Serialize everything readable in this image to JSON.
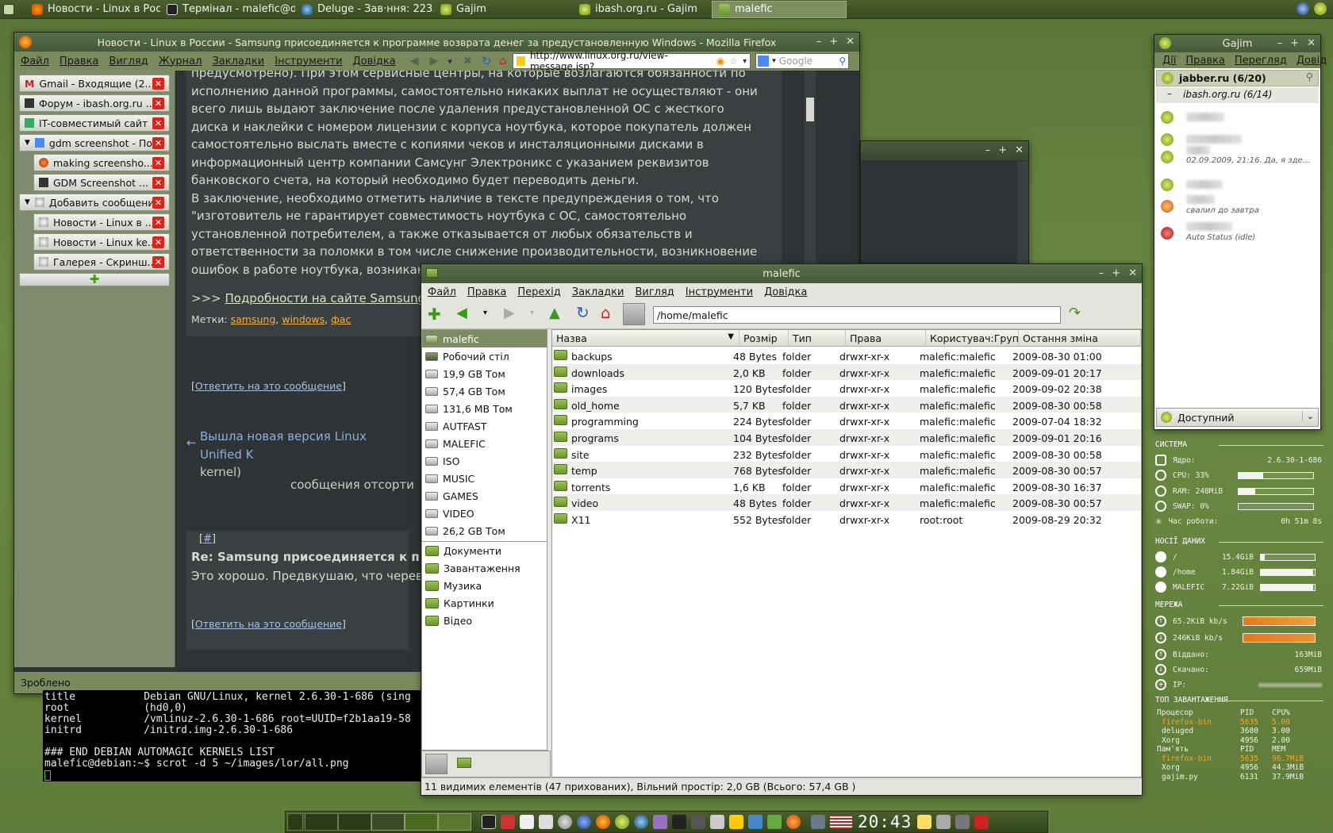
{
  "top_panel": {
    "tasks": [
      {
        "label": "Новости - Linux в Росс..."
      },
      {
        "label": "Термінал - malefic@d..."
      },
      {
        "label": "Deluge - Зав·ння: 223..."
      },
      {
        "label": "Gajim"
      },
      {
        "label": "ibash.org.ru - Gajim"
      },
      {
        "label": "malefic"
      }
    ]
  },
  "firefox": {
    "title": "Новости - Linux в России - Samsung присоединяется к программе возврата денег за предустановленную Windows - Mozilla Firefox",
    "menu": [
      "Файл",
      "Правка",
      "Вигляд",
      "Журнал",
      "Закладки",
      "Інструменти",
      "Довідка"
    ],
    "url": "http://www.linux.org.ru/view-message.jsp?",
    "search_placeholder": "Google",
    "tabs": [
      {
        "label": "Gmail - Входящие (2..."
      },
      {
        "label": "Форум - ibash.org.ru ..."
      },
      {
        "label": "IT-совместимый сайт"
      },
      {
        "label": "gdm screenshot - По..."
      },
      {
        "label": "making screensho..."
      },
      {
        "label": "GDM Screenshot ..."
      },
      {
        "label": "Добавить сообщение"
      },
      {
        "label": "Новости - Linux в ..."
      },
      {
        "label": "Новости - Linux ke..."
      },
      {
        "label": "Галерея - Скринш..."
      }
    ],
    "article": {
      "p1": "предусмотрено). При этом сервисные центры, на которые возлагаются обязанности по исполнению данной программы, самостоятельно никаких выплат не осуществляют - они всего лишь выдают заключение после удаления предустановленной ОС с жесткого диска и наклейки с номером лицензии с корпуса ноутбука, которое покупатель должен самостоятельно выслать вместе с копиями чеков и инсталяционными дисками в информационный центр компании Самсунг Электроникс с указанием реквизитов банковского счета, на который необходимо будет переводить деньги.",
      "p2": "В заключение, необходимо отметить наличие в тексте предупреждения о том, что \"изготовитель не гарантирует совместимость ноутбука с ОС, самостоятельно установленной потребителем, а также отказывается от любых обязательств и ответственности за поломки в том числе снижение производительности, возникновение ошибок в работе ноутбука, возникающие по причине установки иной ОС\".",
      "more_prefix": ">>> ",
      "more_link": "Подробности на сайте Samsung",
      "tags_label": "Метки: ",
      "tags": [
        "samsung",
        "windows",
        "фас"
      ],
      "reply1": "Ответить на это сообщение",
      "prev_link": "Вышла новая версия Linux Unified K",
      "prev_suffix": "kernel)",
      "sorted_text": "сообщения отсорти",
      "comment_hash": "#",
      "comment_title": "Re: Samsung присоединяется к про",
      "comment_text": "Это хорошо. Предвкушаю, что черев",
      "reply2": "Ответить на это сообщение"
    },
    "status": "Зроблено"
  },
  "terminal": {
    "lines": [
      "title           Debian GNU/Linux, kernel 2.6.30-1-686 (sing",
      "root            (hd0,0)",
      "kernel          /vmlinuz-2.6.30-1-686 root=UUID=f2b1aa19-58",
      "initrd          /initrd.img-2.6.30-1-686",
      "",
      "### END DEBIAN AUTOMAGIC KERNELS LIST",
      "malefic@debian:~$ scrot -d 5 ~/images/lor/all.png"
    ]
  },
  "nautilus": {
    "title": "malefic",
    "menu": [
      "Файл",
      "Правка",
      "Перехід",
      "Закладки",
      "Вигляд",
      "Інструменти",
      "Довідка"
    ],
    "path": "/home/malefic",
    "places_devices": [
      {
        "label": "malefic",
        "selected": true
      },
      {
        "label": "Робочий стіл"
      },
      {
        "label": "19,9 GB Том"
      },
      {
        "label": "57,4 GB Том"
      },
      {
        "label": "131,6 MB Том"
      },
      {
        "label": "AUTFAST"
      },
      {
        "label": "MALEFIC"
      },
      {
        "label": "ISO"
      },
      {
        "label": "MUSIC"
      },
      {
        "label": "GAMES"
      },
      {
        "label": "VIDEO"
      },
      {
        "label": "26,2 GB Том"
      }
    ],
    "places_bookmarks": [
      {
        "label": "Документи"
      },
      {
        "label": "Завантаження"
      },
      {
        "label": "Музика"
      },
      {
        "label": "Картинки"
      },
      {
        "label": "Відео"
      }
    ],
    "columns": [
      "Назва",
      "Розмір",
      "Тип",
      "Права доступу",
      "Користувач:Група",
      "Остання зміна"
    ],
    "files": [
      {
        "name": "backups",
        "size": "48 Bytes",
        "type": "folder",
        "perm": "drwxr-xr-x",
        "owner": "malefic:malefic",
        "modified": "2009-08-30 01:00"
      },
      {
        "name": "downloads",
        "size": "2,0 KB",
        "type": "folder",
        "perm": "drwxr-xr-x",
        "owner": "malefic:malefic",
        "modified": "2009-09-01 20:17"
      },
      {
        "name": "images",
        "size": "120 Bytes",
        "type": "folder",
        "perm": "drwxr-xr-x",
        "owner": "malefic:malefic",
        "modified": "2009-09-02 20:38"
      },
      {
        "name": "old_home",
        "size": "5,7 KB",
        "type": "folder",
        "perm": "drwxr-xr-x",
        "owner": "malefic:malefic",
        "modified": "2009-08-30 00:58"
      },
      {
        "name": "programming",
        "size": "224 Bytes",
        "type": "folder",
        "perm": "drwxr-xr-x",
        "owner": "malefic:malefic",
        "modified": "2009-07-04 18:32"
      },
      {
        "name": "programs",
        "size": "104 Bytes",
        "type": "folder",
        "perm": "drwxr-xr-x",
        "owner": "malefic:malefic",
        "modified": "2009-09-01 20:16"
      },
      {
        "name": "site",
        "size": "232 Bytes",
        "type": "folder",
        "perm": "drwxr-xr-x",
        "owner": "malefic:malefic",
        "modified": "2009-08-30 00:58"
      },
      {
        "name": "temp",
        "size": "768 Bytes",
        "type": "folder",
        "perm": "drwxr-xr-x",
        "owner": "malefic:malefic",
        "modified": "2009-08-30 00:57"
      },
      {
        "name": "torrents",
        "size": "1,6 KB",
        "type": "folder",
        "perm": "drwxr-xr-x",
        "owner": "malefic:malefic",
        "modified": "2009-08-30 16:37"
      },
      {
        "name": "video",
        "size": "48 Bytes",
        "type": "folder",
        "perm": "drwxr-xr-x",
        "owner": "malefic:malefic",
        "modified": "2009-08-30 00:57"
      },
      {
        "name": "X11",
        "size": "552 Bytes",
        "type": "folder",
        "perm": "drwxr-xr-x",
        "owner": "root:root",
        "modified": "2009-08-29 20:32"
      }
    ],
    "status": "11 видимих елементів (47 прихованих), Вільний простір: 2,0 GB (Всього: 57,4 GB )"
  },
  "gajim": {
    "title": "Gajim",
    "menu": [
      "Дії",
      "Правка",
      "Перегляд",
      "Довід"
    ],
    "account": "jabber.ru (6/20)",
    "group": "ibash.org.ru (6/14)",
    "contacts": [
      {
        "status_text": ""
      },
      {
        "status_text": ""
      },
      {
        "status_text": "02.09.2009, 21:16. Да, я зде..."
      },
      {
        "status_text": ""
      },
      {
        "status_text": "свалил до завтра"
      },
      {
        "status_text": "Auto Status (idle)"
      }
    ],
    "presence": "Доступний"
  },
  "conky": {
    "system_header": "СИСТЕМА",
    "kernel_label": "Ядро:",
    "kernel": "2.6.30-1-686",
    "cpu_label": "CPU: 33%",
    "cpu": 0.33,
    "ram_label": "RAM: 248MiB",
    "ram": 0.22,
    "swap_label": "SWAP: 0%",
    "swap": 0,
    "uptime_label": "Час роботи:",
    "uptime": "0h 51m 8s",
    "storage_header": "НОСІЇ ДАНИХ",
    "disks": [
      {
        "mount": "/",
        "size": "15.4GiB",
        "used": 0.08
      },
      {
        "mount": "/home",
        "size": "1.84GiB",
        "used": 0.97
      },
      {
        "mount": "MALEFIC",
        "size": "7.22GiB",
        "used": 0.97
      }
    ],
    "net_header": "МЕРЕЖА",
    "up_speed": "65.2KiB kb/s",
    "down_speed": "246KiB kb/s",
    "sent_label": "Віддано:",
    "sent": "163MiB",
    "recv_label": "Скачано:",
    "recv": "659MiB",
    "ip_label": "IP:",
    "top_header": "ТОП ЗАВАНТАЖЕННЯ",
    "cpu_table_head": [
      "Процесор",
      "PID",
      "CPU%"
    ],
    "cpu_procs": [
      {
        "name": "firefox-bin",
        "pid": "5635",
        "val": "5.00"
      },
      {
        "name": "deluged",
        "pid": "3680",
        "val": "3.00"
      },
      {
        "name": "Xorg",
        "pid": "4956",
        "val": "2.00"
      }
    ],
    "mem_table_head": [
      "Пам'ять",
      "PID",
      "MEM"
    ],
    "mem_procs": [
      {
        "name": "firefox-bin",
        "pid": "5635",
        "val": "96.7MiB"
      },
      {
        "name": "Xorg",
        "pid": "4956",
        "val": "44.3MiB"
      },
      {
        "name": "gajim.py",
        "pid": "6131",
        "val": "37.9MiB"
      }
    ],
    "highlight_color": "#f0a830"
  },
  "bottom_panel": {
    "clock": "20:43"
  }
}
